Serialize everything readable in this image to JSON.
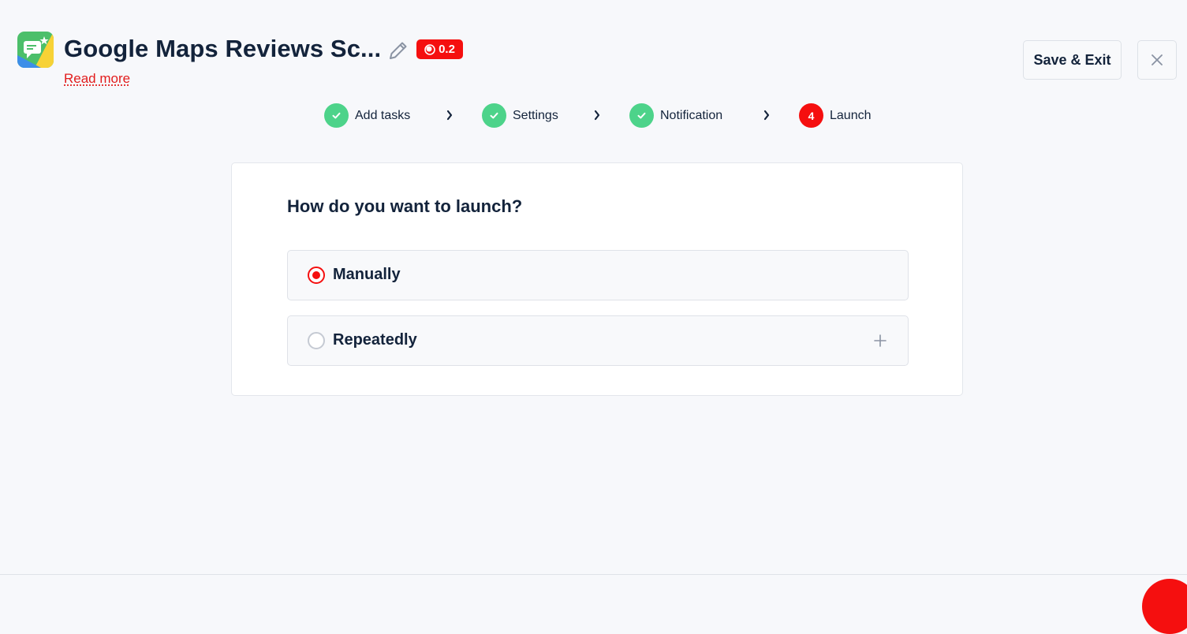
{
  "header": {
    "title": "Google Maps Reviews Sc...",
    "version": "0.2",
    "read_more": "Read more",
    "save_exit_label": "Save & Exit"
  },
  "steps": [
    {
      "label": "Add tasks",
      "status": "done"
    },
    {
      "label": "Settings",
      "status": "done"
    },
    {
      "label": "Notification",
      "status": "done"
    },
    {
      "label": "Launch",
      "status": "active",
      "number": "4"
    }
  ],
  "launch": {
    "question": "How do you want to launch?",
    "options": [
      {
        "label": "Manually",
        "selected": true
      },
      {
        "label": "Repeatedly",
        "selected": false,
        "expand_icon": "plus-icon"
      }
    ]
  },
  "colors": {
    "accent": "#f50f0f",
    "done": "#4dd38a",
    "text": "#13233b"
  }
}
